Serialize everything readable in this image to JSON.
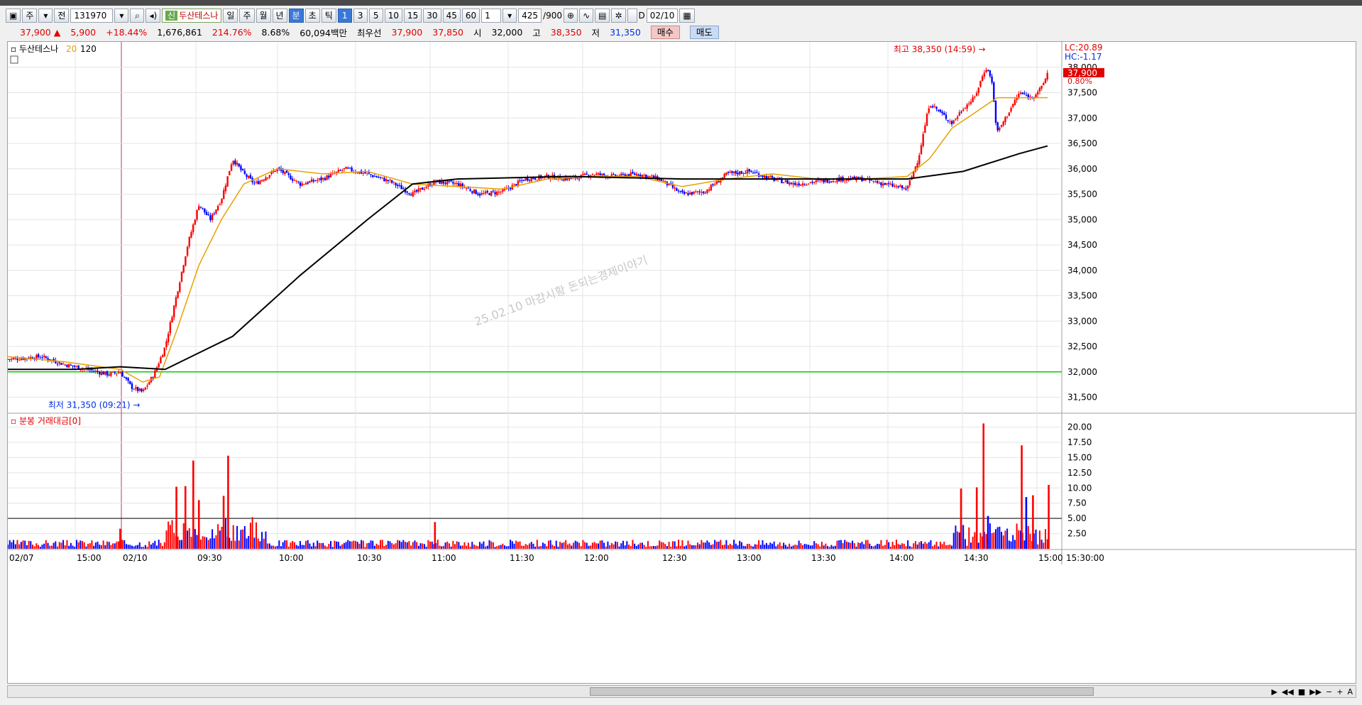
{
  "toolbar": {
    "type_label": "주",
    "market_label": "전",
    "code": "131970",
    "badge": "신",
    "stock_name": "두산테스나",
    "periods": [
      "일",
      "주",
      "월",
      "년",
      "분",
      "초",
      "틱"
    ],
    "intervals": [
      "1",
      "3",
      "5",
      "10",
      "15",
      "30",
      "45",
      "60"
    ],
    "unit_value": "1",
    "count": "425",
    "count_total": "/900",
    "date_check_label": "D",
    "date": "02/10"
  },
  "quote": {
    "price": "37,900",
    "change": "5,900",
    "change_pct": "+18.44%",
    "volume": "1,676,861",
    "volume_ratio": "214.76%",
    "turnover": "8.68%",
    "amount": "60,094백만",
    "best_label": "최우선",
    "ask": "37,900",
    "bid": "37,850",
    "open_label": "시",
    "open": "32,000",
    "high_label": "고",
    "high": "38,350",
    "low_label": "저",
    "low": "31,350",
    "buy_label": "매수",
    "sell_label": "매도"
  },
  "price_legend": {
    "name": "두산테스나",
    "ma1": "20",
    "ma2": "120",
    "ma1_color": "#e8a000",
    "ma2_color": "#000000"
  },
  "volume_legend": {
    "title": "분봉 거래대금[0]"
  },
  "annotations": {
    "high_text": "최고 38,350 (14:59)",
    "low_text": "최저 31,350 (09:21)",
    "watermark": "25.02.10 마감시황 돈되는경제이야기",
    "lc": "LC:20.89",
    "hc": "HC:-1.17",
    "last_price_tag": "37,900",
    "last_pct_tag": "0.80%"
  },
  "chart_data": [
    {
      "type": "candlestick",
      "title": "두산테스나",
      "x_labels": [
        "02/07",
        "15:00",
        "02/10",
        "09:30",
        "10:00",
        "10:30",
        "11:00",
        "11:30",
        "12:00",
        "12:30",
        "13:00",
        "13:30",
        "14:00",
        "14:30",
        "15:00",
        "15:30:00"
      ],
      "y_ticks": [
        31500,
        32000,
        32500,
        33000,
        33500,
        34000,
        34500,
        35000,
        35500,
        36000,
        36500,
        37000,
        37500,
        38000
      ],
      "ylim": [
        31200,
        38500
      ],
      "reference_line": 32000,
      "ohlc_summary": {
        "open": 32000,
        "high": 38350,
        "low": 31350,
        "close": 37900
      },
      "moving_averages": [
        {
          "name": "20",
          "color": "#e8a000"
        },
        {
          "name": "120",
          "color": "#000000"
        }
      ],
      "close_path": [
        [
          0,
          32250
        ],
        [
          30,
          32300
        ],
        [
          50,
          32150
        ],
        [
          70,
          32050
        ],
        [
          90,
          31950
        ],
        [
          100,
          32000
        ],
        [
          110,
          31700
        ],
        [
          120,
          31600
        ],
        [
          130,
          31950
        ],
        [
          140,
          32500
        ],
        [
          150,
          33500
        ],
        [
          160,
          34500
        ],
        [
          170,
          35300
        ],
        [
          180,
          35000
        ],
        [
          190,
          35400
        ],
        [
          200,
          36200
        ],
        [
          210,
          35900
        ],
        [
          220,
          35700
        ],
        [
          240,
          36000
        ],
        [
          260,
          35700
        ],
        [
          280,
          35800
        ],
        [
          300,
          36000
        ],
        [
          320,
          35900
        ],
        [
          340,
          35750
        ],
        [
          360,
          35500
        ],
        [
          380,
          35750
        ],
        [
          400,
          35700
        ],
        [
          420,
          35500
        ],
        [
          440,
          35550
        ],
        [
          460,
          35800
        ],
        [
          480,
          35850
        ],
        [
          500,
          35800
        ],
        [
          520,
          35900
        ],
        [
          540,
          35850
        ],
        [
          560,
          35900
        ],
        [
          580,
          35800
        ],
        [
          600,
          35500
        ],
        [
          620,
          35550
        ],
        [
          640,
          35900
        ],
        [
          660,
          35950
        ],
        [
          680,
          35800
        ],
        [
          700,
          35700
        ],
        [
          720,
          35750
        ],
        [
          740,
          35800
        ],
        [
          760,
          35800
        ],
        [
          780,
          35700
        ],
        [
          800,
          35600
        ],
        [
          810,
          36200
        ],
        [
          820,
          37300
        ],
        [
          830,
          37100
        ],
        [
          840,
          36900
        ],
        [
          850,
          37200
        ],
        [
          860,
          37400
        ],
        [
          870,
          38000
        ],
        [
          875,
          37800
        ],
        [
          880,
          36700
        ],
        [
          890,
          37100
        ],
        [
          900,
          37500
        ],
        [
          910,
          37400
        ],
        [
          920,
          37600
        ],
        [
          925,
          37900
        ]
      ],
      "ma20_path": [
        [
          0,
          32300
        ],
        [
          50,
          32200
        ],
        [
          100,
          32050
        ],
        [
          120,
          31800
        ],
        [
          135,
          31900
        ],
        [
          150,
          32800
        ],
        [
          170,
          34100
        ],
        [
          190,
          35000
        ],
        [
          210,
          35700
        ],
        [
          240,
          36000
        ],
        [
          280,
          35900
        ],
        [
          320,
          35950
        ],
        [
          360,
          35700
        ],
        [
          400,
          35650
        ],
        [
          440,
          35600
        ],
        [
          480,
          35800
        ],
        [
          520,
          35850
        ],
        [
          560,
          35850
        ],
        [
          600,
          35650
        ],
        [
          640,
          35800
        ],
        [
          680,
          35900
        ],
        [
          720,
          35800
        ],
        [
          760,
          35800
        ],
        [
          800,
          35850
        ],
        [
          820,
          36200
        ],
        [
          840,
          36800
        ],
        [
          860,
          37100
        ],
        [
          880,
          37400
        ],
        [
          900,
          37400
        ],
        [
          925,
          37400
        ]
      ],
      "ma120_path": [
        [
          0,
          32050
        ],
        [
          60,
          32050
        ],
        [
          100,
          32100
        ],
        [
          140,
          32050
        ],
        [
          200,
          32700
        ],
        [
          260,
          33900
        ],
        [
          320,
          35000
        ],
        [
          360,
          35700
        ],
        [
          400,
          35800
        ],
        [
          500,
          35850
        ],
        [
          600,
          35800
        ],
        [
          700,
          35800
        ],
        [
          800,
          35800
        ],
        [
          850,
          35950
        ],
        [
          900,
          36300
        ],
        [
          925,
          36450
        ]
      ]
    },
    {
      "type": "bar",
      "title": "분봉 거래대금[0]",
      "y_ticks": [
        2.5,
        5.0,
        7.5,
        10.0,
        12.5,
        15.0,
        17.5,
        20.0
      ],
      "ylim": [
        0,
        21
      ],
      "reference_line": 5.0,
      "spikes": [
        {
          "x": 100,
          "value": 3.3,
          "color": "red"
        },
        {
          "x": 150,
          "value": 10.2,
          "color": "red"
        },
        {
          "x": 158,
          "value": 10.3,
          "color": "red"
        },
        {
          "x": 165,
          "value": 14.5,
          "color": "red"
        },
        {
          "x": 170,
          "value": 8.0,
          "color": "red"
        },
        {
          "x": 196,
          "value": 15.3,
          "color": "red"
        },
        {
          "x": 192,
          "value": 8.7,
          "color": "red"
        },
        {
          "x": 380,
          "value": 4.4,
          "color": "red"
        },
        {
          "x": 848,
          "value": 9.9,
          "color": "red"
        },
        {
          "x": 862,
          "value": 10.1,
          "color": "red"
        },
        {
          "x": 868,
          "value": 20.6,
          "color": "red"
        },
        {
          "x": 872,
          "value": 5.4,
          "color": "blue"
        },
        {
          "x": 902,
          "value": 17.0,
          "color": "red"
        },
        {
          "x": 906,
          "value": 8.5,
          "color": "blue"
        },
        {
          "x": 912,
          "value": 8.8,
          "color": "red"
        },
        {
          "x": 926,
          "value": 10.5,
          "color": "red"
        }
      ]
    }
  ]
}
